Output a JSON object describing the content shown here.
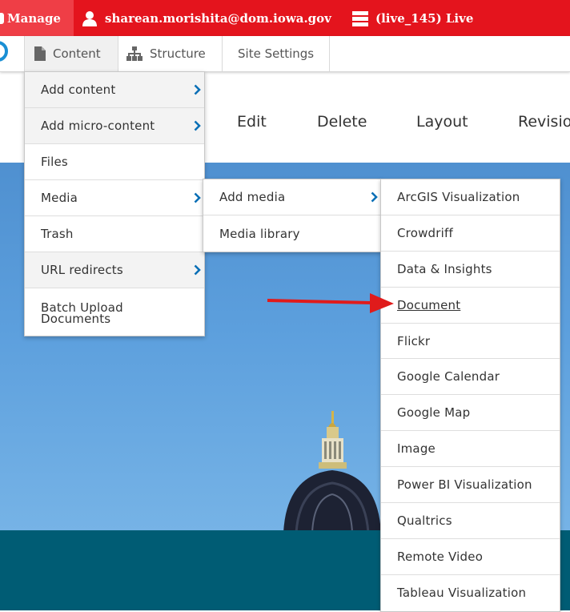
{
  "admin_bar": {
    "manage_label": "Manage",
    "user_email": "sharean.morishita@dom.iowa.gov",
    "environment_label": "(live_145) Live"
  },
  "tray": {
    "tabs": [
      {
        "label": "Content",
        "icon": "document-icon"
      },
      {
        "label": "Structure",
        "icon": "sitemap-icon"
      },
      {
        "label": "Site Settings"
      }
    ]
  },
  "page": {
    "actions": [
      "Edit",
      "Delete",
      "Layout",
      "Revisio"
    ]
  },
  "content_menu": {
    "items": [
      {
        "label": "Add content",
        "has_submenu": true
      },
      {
        "label": "Add micro-content",
        "has_submenu": true
      },
      {
        "label": "Files",
        "has_submenu": false
      },
      {
        "label": "Media",
        "has_submenu": true
      },
      {
        "label": "Trash",
        "has_submenu": false
      },
      {
        "label": "URL redirects",
        "has_submenu": true
      },
      {
        "label": "Batch Upload Documents",
        "line1": "Batch Upload",
        "line2": "Documents",
        "has_submenu": false
      }
    ]
  },
  "media_menu": {
    "items": [
      {
        "label": "Add media",
        "has_submenu": true
      },
      {
        "label": "Media library",
        "has_submenu": false
      }
    ]
  },
  "add_media_menu": {
    "items": [
      {
        "label": "ArcGIS Visualization"
      },
      {
        "label": "Crowdriff"
      },
      {
        "label": "Data & Insights"
      },
      {
        "label": "Document"
      },
      {
        "label": "Flickr"
      },
      {
        "label": "Google Calendar"
      },
      {
        "label": "Google Map"
      },
      {
        "label": "Image"
      },
      {
        "label": "Power BI Visualization"
      },
      {
        "label": "Qualtrics"
      },
      {
        "label": "Remote Video"
      },
      {
        "label": "Tableau Visualization"
      }
    ]
  },
  "colors": {
    "admin_bar_red": "#e4141d",
    "manage_red": "#ef3e46",
    "chevron_blue": "#0a6fb6",
    "annotation_arrow": "#e01b1b",
    "sky_blue": "#5c9fdd",
    "footer_teal": "#005c74"
  }
}
